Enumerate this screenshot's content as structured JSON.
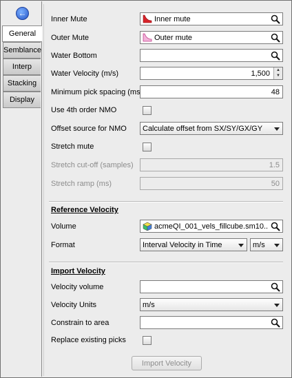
{
  "tabs": [
    "General",
    "Semblance",
    "Interp",
    "Stacking",
    "Display"
  ],
  "general": {
    "inner_mute_label": "Inner Mute",
    "inner_mute_value": "Inner mute",
    "outer_mute_label": "Outer Mute",
    "outer_mute_value": "Outer mute",
    "water_bottom_label": "Water Bottom",
    "water_bottom_value": "",
    "water_velocity_label": "Water Velocity (m/s)",
    "water_velocity_value": "1,500",
    "min_pick_spacing_label": "Minimum pick spacing (ms)",
    "min_pick_spacing_value": "48",
    "use_4th_order_label": "Use 4th order NMO",
    "use_4th_order_checked": false,
    "offset_source_label": "Offset source for NMO",
    "offset_source_value": "Calculate offset from SX/SY/GX/GY",
    "stretch_mute_label": "Stretch mute",
    "stretch_mute_checked": false,
    "stretch_cutoff_label": "Stretch cut-off (samples)",
    "stretch_cutoff_value": "1.5",
    "stretch_ramp_label": "Stretch ramp (ms)",
    "stretch_ramp_value": "50"
  },
  "reference_velocity": {
    "heading": "Reference Velocity",
    "volume_label": "Volume",
    "volume_value": "acmeQI_001_vels_fillcube.sm10...",
    "format_label": "Format",
    "format_value": "Interval Velocity in Time",
    "unit_value": "m/s"
  },
  "import_velocity": {
    "heading": "Import Velocity",
    "velocity_volume_label": "Velocity volume",
    "velocity_volume_value": "",
    "velocity_units_label": "Velocity Units",
    "velocity_units_value": "m/s",
    "constrain_label": "Constrain to area",
    "constrain_value": "",
    "replace_label": "Replace existing picks",
    "replace_checked": false,
    "import_button": "Import Velocity"
  },
  "colors": {
    "inner_mute_icon": "#d8232a",
    "outer_mute_icon": "#e25aa8"
  }
}
